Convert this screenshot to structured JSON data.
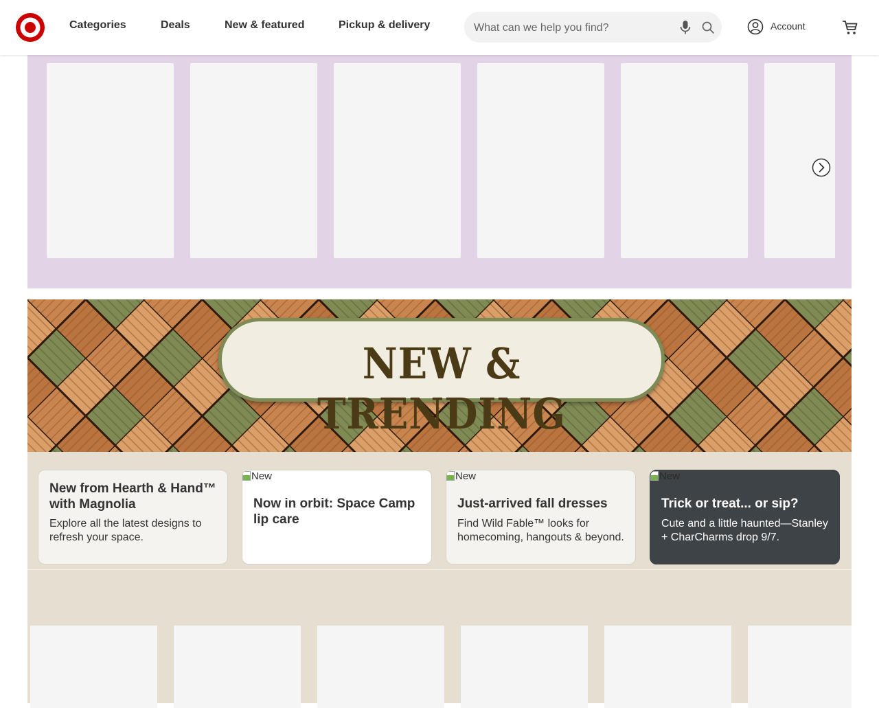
{
  "header": {
    "logo_alt": "Target",
    "nav": [
      "Categories",
      "Deals",
      "New & featured",
      "Pickup & delivery"
    ],
    "search_placeholder": "What can we help you find?",
    "account_label": "Account"
  },
  "carousel": {
    "card_count_visible": 6
  },
  "banner": {
    "title": "NEW & TRENDING"
  },
  "tiles": [
    {
      "image_alt": "",
      "title": "New from Hearth & Hand™ with Magnolia",
      "description": "Explore all the latest designs to refresh your space.",
      "theme": "light"
    },
    {
      "image_alt": "New",
      "title": "Now in orbit: Space Camp lip care",
      "description": "",
      "theme": "white"
    },
    {
      "image_alt": "New",
      "title": "Just-arrived fall dresses",
      "description": "Find Wild Fable™ looks for homecoming, hangouts & beyond.",
      "theme": "light"
    },
    {
      "image_alt": "New",
      "title": "Trick or treat... or sip?",
      "description": "Cute and a little haunted—Stanley + CharCharms drop 9/7.",
      "theme": "dark"
    }
  ],
  "colors": {
    "brand_red": "#cc0000",
    "purple_band": "#e3d3e6",
    "beige_band": "#e6dfd1",
    "dark_tile": "#3d4347",
    "pill_border": "#7d8b56",
    "title_brown": "#4a3a16"
  },
  "icons": {
    "logo": "target-bullseye-icon",
    "mic": "microphone-icon",
    "search": "search-icon",
    "account": "account-circle-icon",
    "cart": "cart-icon",
    "next": "chevron-right-circle-icon"
  }
}
